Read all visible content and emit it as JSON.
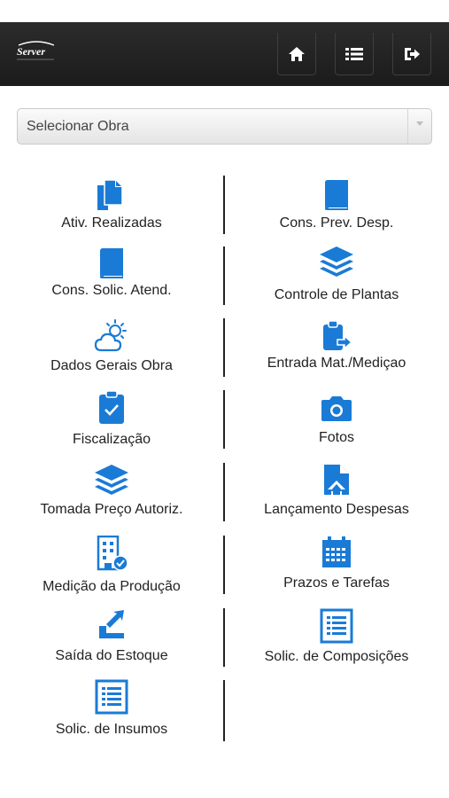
{
  "header": {
    "logo_text": "Server",
    "nav": [
      "home-icon",
      "list-icon",
      "logout-icon"
    ]
  },
  "select": {
    "value": "Selecionar Obra"
  },
  "colors": {
    "accent": "#1a7bd6",
    "navbar": "#222222",
    "text": "#222222"
  },
  "menu": {
    "left": [
      {
        "label": "Ativ. Realizadas",
        "icon": "copy-documents-icon"
      },
      {
        "label": "Cons. Solic. Atend.",
        "icon": "book-icon"
      },
      {
        "label": "Dados Gerais Obra",
        "icon": "weather-sun-cloud-icon"
      },
      {
        "label": "Fiscalização",
        "icon": "clipboard-check-icon"
      },
      {
        "label": "Tomada Preço Autoriz.",
        "icon": "layers-icon"
      },
      {
        "label": "Medição da Produção",
        "icon": "building-check-icon"
      },
      {
        "label": "Saída do Estoque",
        "icon": "stock-out-icon"
      },
      {
        "label": "Solic. de Insumos",
        "icon": "list-document-icon"
      }
    ],
    "right": [
      {
        "label": "Cons. Prev. Desp.",
        "icon": "book-icon"
      },
      {
        "label": "Controle de Plantas",
        "icon": "layers-icon"
      },
      {
        "label": "Entrada Mat./Mediçao",
        "icon": "clipboard-import-icon"
      },
      {
        "label": "Fotos",
        "icon": "camera-icon"
      },
      {
        "label": "Lançamento Despesas",
        "icon": "file-upload-icon"
      },
      {
        "label": "Prazos e Tarefas",
        "icon": "calendar-icon"
      },
      {
        "label": "Solic. de Composições",
        "icon": "list-document-icon"
      }
    ]
  }
}
